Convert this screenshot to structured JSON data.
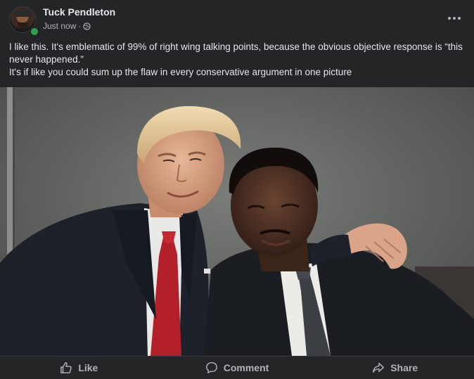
{
  "post": {
    "author": "Tuck Pendleton",
    "timestamp": "Just now",
    "separator": "·",
    "privacy_icon": "globe-icon",
    "online": true,
    "more_icon": "more-horizontal-icon",
    "text_lines": [
      "I like this. It's emblematic of 99% of right wing talking points, because the obvious objective response is “this never happened.”",
      "It's if like you could sum up the flaw in every conservative argument in one picture"
    ],
    "photo_icon": "photo"
  },
  "actions": {
    "like_label": "Like",
    "comment_label": "Comment",
    "share_label": "Share",
    "like_icon": "thumbs-up-icon",
    "comment_icon": "speech-bubble-icon",
    "share_icon": "share-arrow-icon"
  },
  "colors": {
    "background": "#242526",
    "text_primary": "#e4e6eb",
    "text_secondary": "#b0b3b8",
    "online": "#31a24c"
  }
}
